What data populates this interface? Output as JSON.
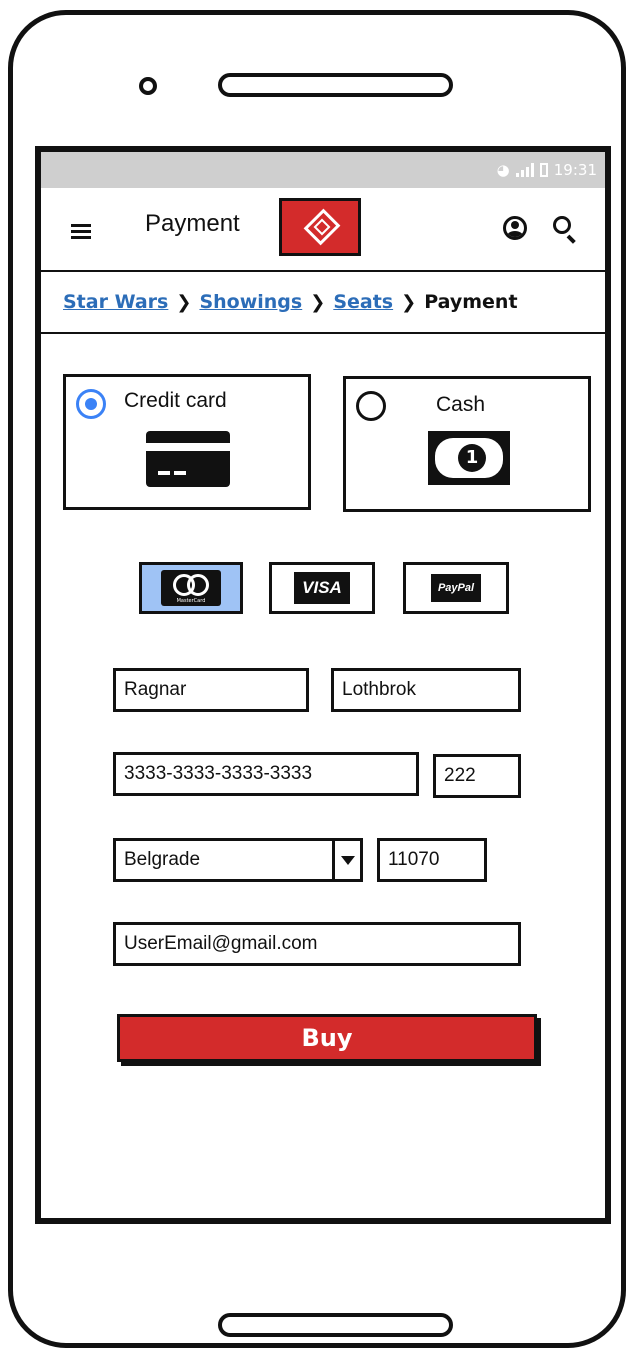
{
  "status_bar": {
    "time": "19:31"
  },
  "header": {
    "title": "Payment",
    "logo_icon": "ticket-icon"
  },
  "breadcrumb": {
    "items": [
      "Star Wars",
      "Showings",
      "Seats"
    ],
    "current": "Payment",
    "separator": "❯"
  },
  "payment_methods": {
    "credit_card": {
      "label": "Credit card",
      "selected": true
    },
    "cash": {
      "label": "Cash",
      "selected": false,
      "coin_text": "1"
    }
  },
  "card_brands": {
    "mastercard": {
      "text": "MasterCard",
      "selected": true
    },
    "visa": {
      "text": "VISA"
    },
    "paypal": {
      "text": "PayPal"
    }
  },
  "form": {
    "first_name": "Ragnar",
    "last_name": "Lothbrok",
    "card_number": "3333-3333-3333-3333",
    "cvv": "222",
    "city": "Belgrade",
    "zip": "11070",
    "email": "UserEmail@gmail.com"
  },
  "buy_button": {
    "label": "Buy"
  },
  "colors": {
    "accent": "#d32b2b",
    "selected_blue": "#3b82f6",
    "brand_selected_bg": "#9fc3f5",
    "link": "#2c6db8"
  }
}
